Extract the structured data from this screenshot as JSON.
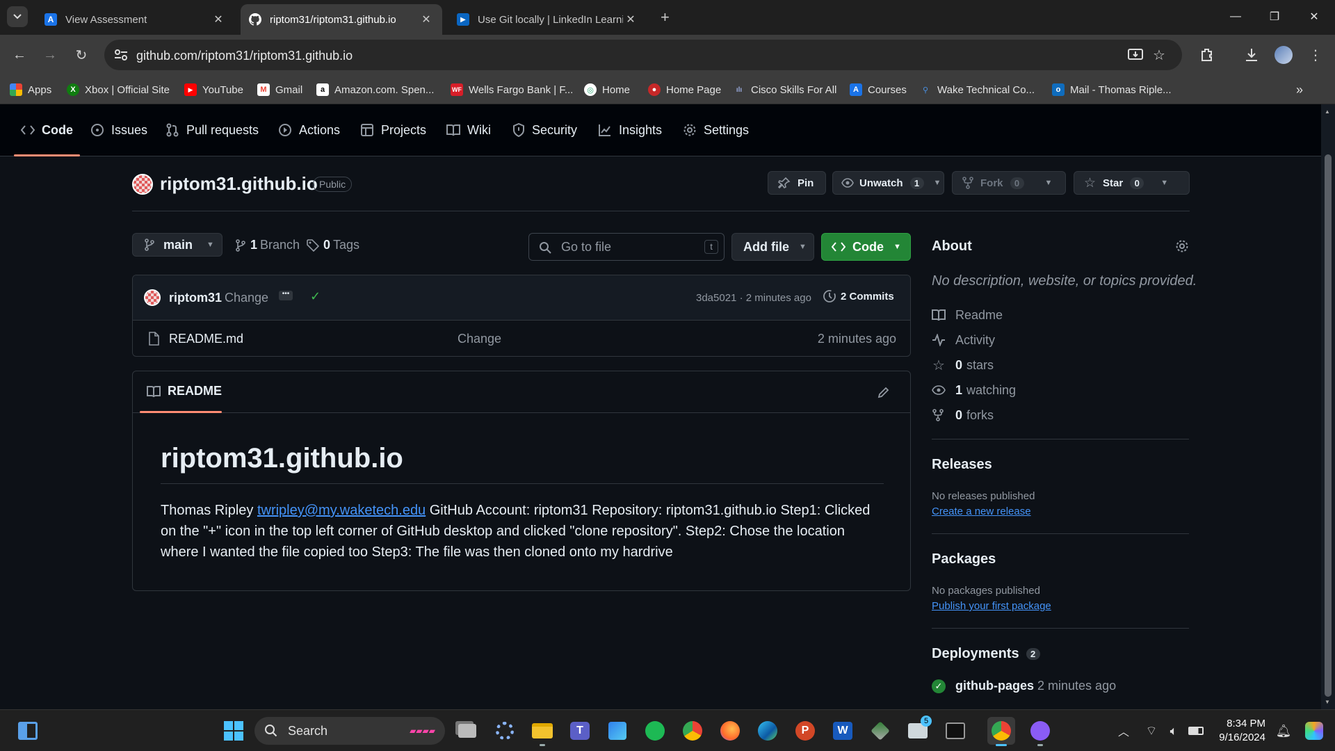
{
  "browser": {
    "tabs": [
      {
        "title": "View Assessment",
        "active": false
      },
      {
        "title": "riptom31/riptom31.github.io",
        "active": true
      },
      {
        "title": "Use Git locally | LinkedIn Learnin",
        "active": false
      }
    ],
    "url": "github.com/riptom31/riptom31.github.io",
    "bookmarks": [
      "Apps",
      "Xbox | Official Site",
      "YouTube",
      "Gmail",
      "Amazon.com. Spen...",
      "Wells Fargo Bank | F...",
      "Home",
      "Home Page",
      "Cisco Skills For All",
      "Courses",
      "Wake Technical Co...",
      "Mail - Thomas Riple..."
    ]
  },
  "repo_nav": [
    "Code",
    "Issues",
    "Pull requests",
    "Actions",
    "Projects",
    "Wiki",
    "Security",
    "Insights",
    "Settings"
  ],
  "repo": {
    "name": "riptom31.github.io",
    "visibility": "Public",
    "pin_label": "Pin",
    "unwatch_label": "Unwatch",
    "watch_count": "1",
    "fork_label": "Fork",
    "fork_count": "0",
    "star_label": "Star",
    "star_count": "0"
  },
  "branch_bar": {
    "branch": "main",
    "branch_count": "1",
    "branch_label": "Branch",
    "tag_count": "0",
    "tag_label": "Tags",
    "search_placeholder": "Go to file",
    "search_shortcut": "t",
    "add_file_label": "Add file",
    "code_label": "Code"
  },
  "commit": {
    "author": "riptom31",
    "message": "Change",
    "hash_time": "3da5021 · 2 minutes ago",
    "commits_count": "2",
    "commits_label": "Commits"
  },
  "files": [
    {
      "name": "README.md",
      "message": "Change",
      "time": "2 minutes ago"
    }
  ],
  "readme": {
    "tab_label": "README",
    "heading": "riptom31.github.io",
    "text_before": "Thomas Ripley ",
    "email": "twripley@my.waketech.edu",
    "text_after": " GitHub Account: riptom31 Repository: riptom31.github.io Step1: Clicked on the \"+\" icon in the top left corner of GitHub desktop and clicked \"clone repository\". Step2: Chose the location where I wanted the file copied too Step3: The file was then cloned onto my hardrive"
  },
  "about": {
    "title": "About",
    "description": "No description, website, or topics provided.",
    "items": {
      "readme": "Readme",
      "activity": "Activity",
      "stars_count": "0",
      "stars_label": "stars",
      "watching_count": "1",
      "watching_label": "watching",
      "forks_count": "0",
      "forks_label": "forks"
    },
    "releases_title": "Releases",
    "releases_text": "No releases published",
    "releases_link": "Create a new release",
    "packages_title": "Packages",
    "packages_text": "No packages published",
    "packages_link": "Publish your first package",
    "deployments_title": "Deployments",
    "deployments_count": "2",
    "deployment_name": "github-pages",
    "deployment_time": "2 minutes ago"
  },
  "taskbar": {
    "search_label": "Search",
    "time": "8:34 PM",
    "date": "9/16/2024",
    "teams_badge": "5"
  },
  "colors": {
    "accent_green": "#238636",
    "link_blue": "#4493f8",
    "tab_underline": "#fd8c73"
  }
}
